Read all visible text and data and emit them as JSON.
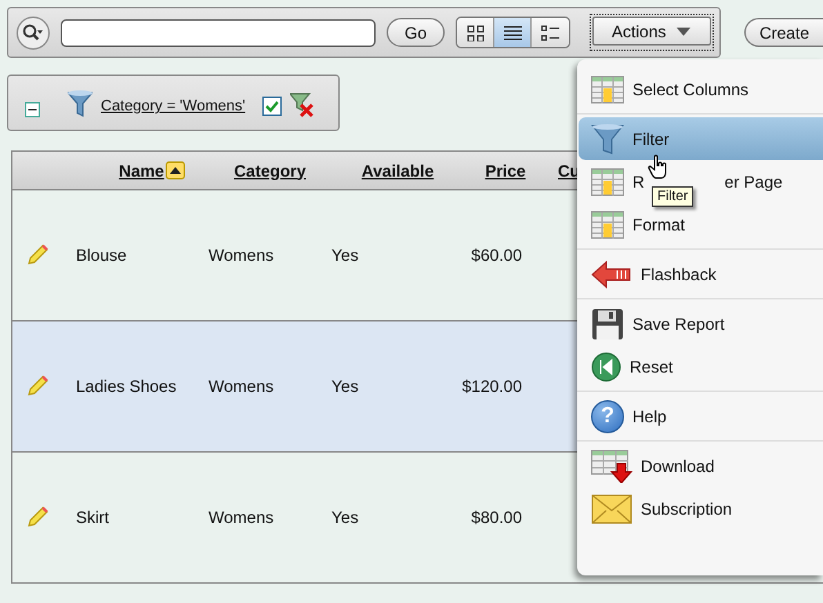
{
  "toolbar": {
    "go": "Go",
    "views": [
      {
        "kind": "icons",
        "selected": false
      },
      {
        "kind": "report",
        "selected": true
      },
      {
        "kind": "detail",
        "selected": false
      }
    ],
    "actions": "Actions",
    "create": "Create"
  },
  "filter": {
    "expanded": true,
    "text": "Category = 'Womens'",
    "checked": true
  },
  "table": {
    "columns": [
      {
        "label": "Name",
        "sorted": true
      },
      {
        "label": "Category",
        "sorted": false
      },
      {
        "label": "Available",
        "sorted": false
      },
      {
        "label": "Price",
        "sorted": false
      },
      {
        "label": "Cu",
        "sorted": false
      }
    ],
    "rows": [
      {
        "selected": false,
        "cells": [
          "Blouse",
          "Womens",
          "Yes",
          "$60.00"
        ]
      },
      {
        "selected": true,
        "cells": [
          "Ladies Shoes",
          "Womens",
          "Yes",
          "$120.00"
        ]
      },
      {
        "selected": false,
        "cells": [
          "Skirt",
          "Womens",
          "Yes",
          "$80.00"
        ]
      }
    ]
  },
  "menu": {
    "groups": [
      [
        {
          "kind": "columns",
          "label": "Select Columns",
          "selected": false
        }
      ],
      [
        {
          "kind": "filter",
          "label": "Filter",
          "selected": true
        },
        {
          "kind": "rows",
          "label": "R",
          "label_after": "er Page",
          "selected": false
        },
        {
          "kind": "format",
          "label": "Format",
          "selected": false
        }
      ],
      [
        {
          "kind": "flashback",
          "label": "Flashback",
          "selected": false
        }
      ],
      [
        {
          "kind": "save",
          "label": "Save Report",
          "selected": false
        },
        {
          "kind": "reset",
          "label": "Reset",
          "selected": false
        }
      ],
      [
        {
          "kind": "help",
          "glyph": "?",
          "label": "Help",
          "selected": false
        }
      ],
      [
        {
          "kind": "download",
          "label": "Download",
          "selected": false
        },
        {
          "kind": "subscription",
          "label": "Subscription",
          "selected": false
        }
      ]
    ],
    "tooltip": "Filter"
  }
}
